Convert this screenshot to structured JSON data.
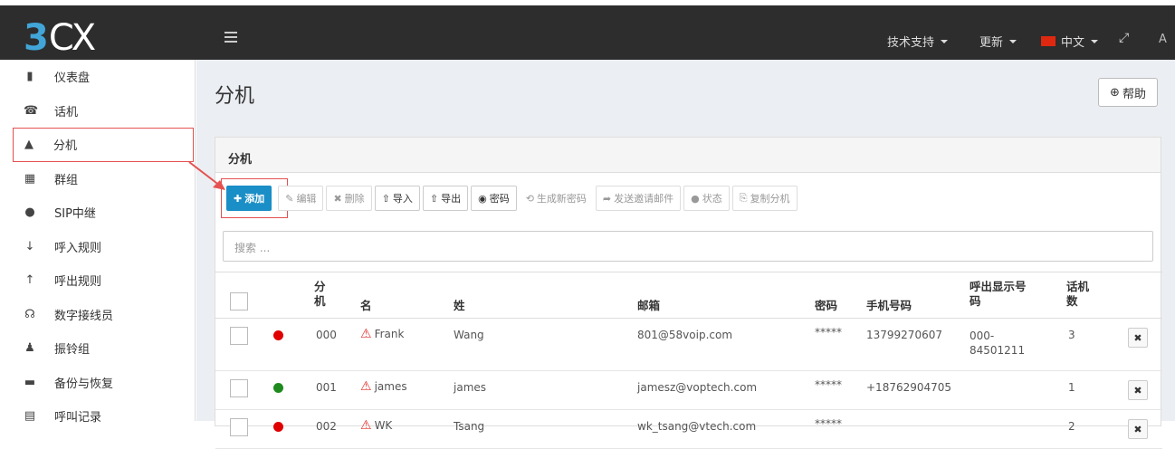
{
  "brand": {
    "logo_prefix": "3",
    "logo_suffix": "CX"
  },
  "topnav": {
    "support": "技术支持",
    "updates": "更新",
    "language": "中文",
    "user_initial": "A"
  },
  "sidebar": {
    "items": [
      {
        "label": "仪表盘",
        "icon": "bar-chart-icon",
        "glyph": "▮"
      },
      {
        "label": "话机",
        "icon": "phone-icon",
        "glyph": "☎"
      },
      {
        "label": "分机",
        "icon": "user-icon",
        "glyph": "▲"
      },
      {
        "label": "群组",
        "icon": "grid-icon",
        "glyph": "▦"
      },
      {
        "label": "SIP中继",
        "icon": "globe-icon",
        "glyph": "●"
      },
      {
        "label": "呼入规则",
        "icon": "arrow-down-icon",
        "glyph": "↓"
      },
      {
        "label": "呼出规则",
        "icon": "arrow-up-icon",
        "glyph": "↑"
      },
      {
        "label": "数字接线员",
        "icon": "headset-icon",
        "glyph": "☊"
      },
      {
        "label": "振铃组",
        "icon": "users-icon",
        "glyph": "♟"
      },
      {
        "label": "备份与恢复",
        "icon": "folder-icon",
        "glyph": "▬"
      },
      {
        "label": "呼叫记录",
        "icon": "list-icon",
        "glyph": "▤"
      }
    ],
    "active_index": 2
  },
  "page": {
    "title": "分机",
    "help_label": "帮助"
  },
  "panel": {
    "title": "分机",
    "toolbar": {
      "add": "添加",
      "edit": "编辑",
      "delete": "删除",
      "import": "导入",
      "export": "导出",
      "password": "密码",
      "regen_password": "生成新密码",
      "send_invite": "发送邀请邮件",
      "status": "状态",
      "copy_ext": "复制分机"
    },
    "search_placeholder": "搜索 ...",
    "table": {
      "headers": {
        "ext_line1": "分",
        "ext_line2": "机",
        "first_name": "名",
        "last_name": "姓",
        "email": "邮箱",
        "password": "密码",
        "mobile": "手机号码",
        "caller_id_line1": "呼出显示号",
        "caller_id_line2": "码",
        "phones_line1": "话机",
        "phones_line2": "数"
      },
      "rows": [
        {
          "status_color": "#e00000",
          "ext": "000",
          "first": "Frank",
          "last": "Wang",
          "email": "801@58voip.com",
          "password": "*****",
          "mobile": "13799270607",
          "caller_id_line1": "000-",
          "caller_id_line2": "84501211",
          "phones": "3"
        },
        {
          "status_color": "#1e8a1e",
          "ext": "001",
          "first": "james",
          "last": "james",
          "email": "jamesz@voptech.com",
          "password": "*****",
          "mobile": "+18762904705",
          "caller_id_line1": "",
          "caller_id_line2": "",
          "phones": "1"
        },
        {
          "status_color": "#e00000",
          "ext": "002",
          "first": "WK",
          "last": "Tsang",
          "email": "wk_tsang@vtech.com",
          "password": "*****",
          "mobile": "",
          "caller_id_line1": "",
          "caller_id_line2": "",
          "phones": "2"
        }
      ]
    }
  },
  "colors": {
    "accent": "#1a8ec6",
    "highlight": "#e55050",
    "topbar": "#2d2d2d"
  }
}
